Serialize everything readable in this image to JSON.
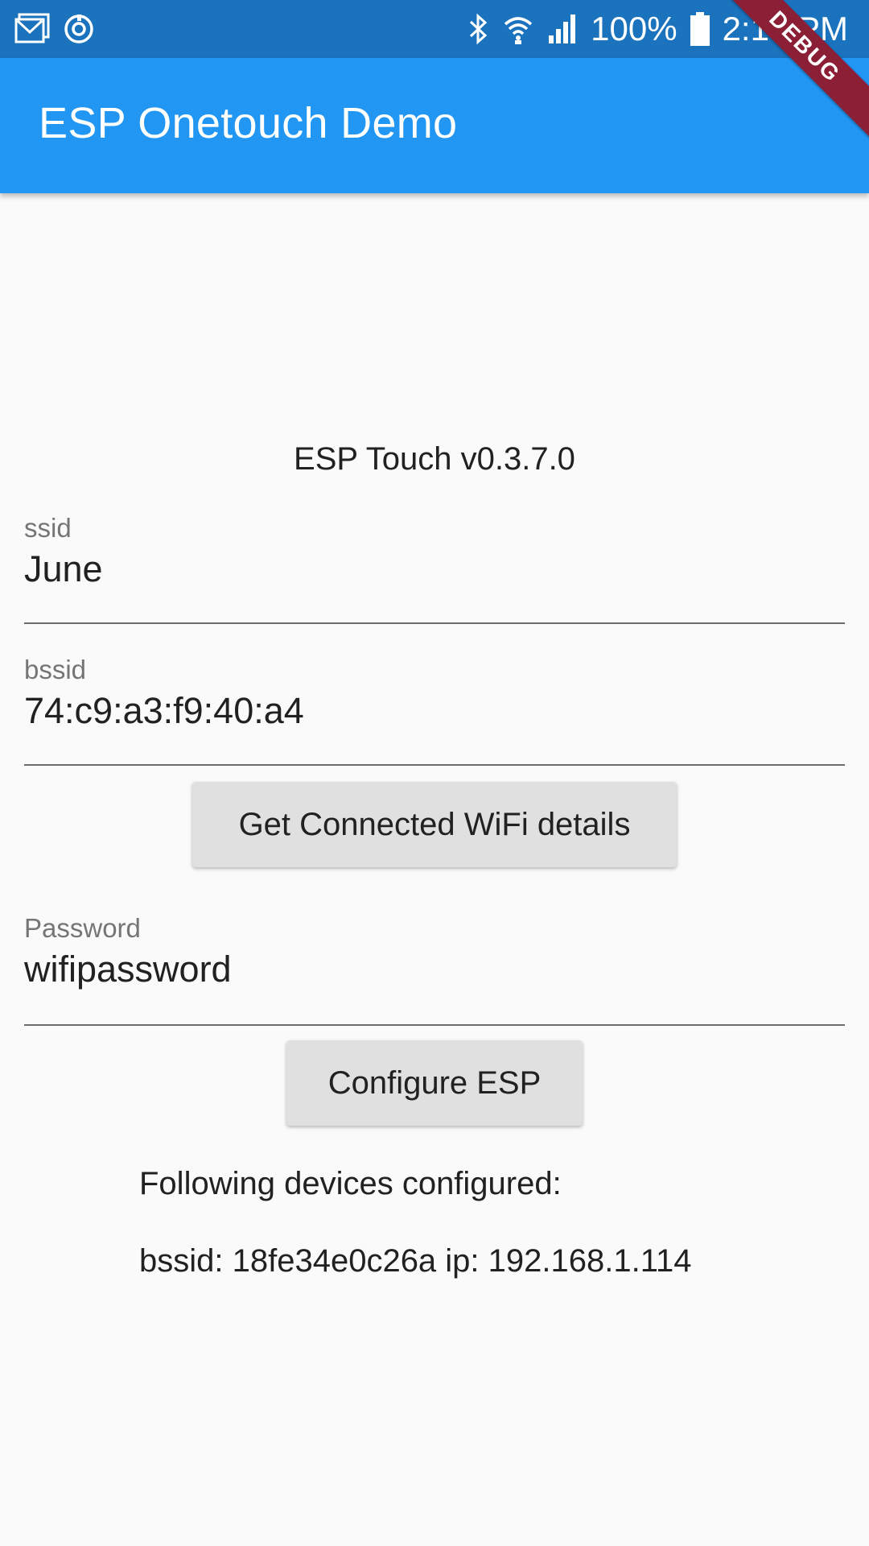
{
  "status_bar": {
    "left_icons": [
      "gmail-icon",
      "sync-icon"
    ],
    "right_icons": [
      "bluetooth-icon",
      "wifi-icon",
      "cell-signal-icon",
      "battery-icon"
    ],
    "battery_percent": "100%",
    "time": "2:19 PM"
  },
  "app_bar": {
    "title": "ESP Onetouch Demo",
    "color": "#2196f3"
  },
  "debug_banner": "DEBUG",
  "version_text": "ESP Touch v0.3.7.0",
  "ssid_field": {
    "label": "ssid",
    "value": "June"
  },
  "bssid_field": {
    "label": "bssid",
    "value": "74:c9:a3:f9:40:a4"
  },
  "get_wifi_button": {
    "label": "Get Connected WiFi details"
  },
  "password_field": {
    "label": "Password",
    "value": "wifipassword"
  },
  "configure_button": {
    "label": "Configure ESP"
  },
  "results": {
    "heading": "Following devices configured:",
    "devices": [
      "bssid: 18fe34e0c26a ip: 192.168.1.114"
    ]
  }
}
